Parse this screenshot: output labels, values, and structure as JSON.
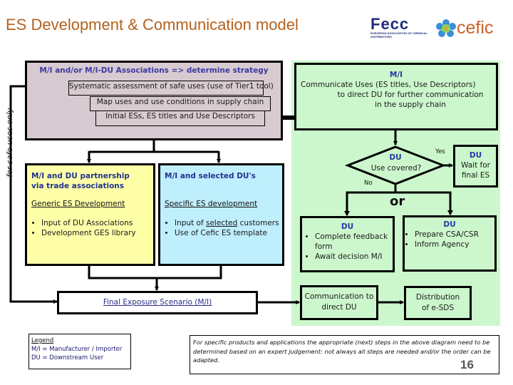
{
  "header": {
    "title": "ES Development & Communication model",
    "logos": [
      {
        "name": "Fecc",
        "subtitle": "EUROPEAN ASSOCIATION OF CHEMICAL DISTRIBUTORS",
        "color": "#1f2b7a"
      },
      {
        "name": "cefic",
        "color": "#c8622a"
      }
    ]
  },
  "side_label": "for safe uses only",
  "strategy_box": {
    "heading": "M/I and/or M/I-DU Associations => determine strategy",
    "steps": [
      "Systematic  assessment of safe uses (use of Tier1 tool)",
      "Map uses and use conditions in supply chain",
      "Initial ESs, ES titles and Use Descriptors"
    ]
  },
  "communicate_box": {
    "heading": "M/I",
    "lines": [
      "Communicate Uses (ES titles, Use Descriptors)",
      "to direct DU for further communication",
      "in the supply chain"
    ]
  },
  "generic_box": {
    "heading_lines": [
      "M/I and DU partnership",
      "via trade associations"
    ],
    "subheading": "Generic ES Development",
    "bullets": [
      "Input of DU Associations",
      "Development GES library"
    ]
  },
  "specific_box": {
    "heading": "M/I and selected DU's",
    "subheading": "Specific ES development",
    "bullets_html": [
      {
        "pre": "Input of ",
        "em": "selected",
        "post": " customers"
      },
      {
        "pre": "Use of Cefic ES template",
        "em": "",
        "post": ""
      }
    ]
  },
  "decision": {
    "heading": "DU",
    "question": "Use covered?",
    "yes_label": "Yes",
    "no_label": "No"
  },
  "wait_box": {
    "heading": "DU",
    "lines": [
      "Wait for",
      "final ES"
    ]
  },
  "or_label": "or",
  "feedback_box": {
    "heading": "DU",
    "bullets": [
      "Complete feedback form",
      "Await decision M/I"
    ]
  },
  "csa_box": {
    "heading": "DU",
    "bullets": [
      "Prepare CSA/CSR",
      "Inform Agency"
    ]
  },
  "final_es": "Final Exposure Scenario (M/I)",
  "communication_box": {
    "lines": [
      "Communication to",
      "direct DU"
    ]
  },
  "distribution_box": {
    "lines": [
      "Distribution",
      "of e-SDS"
    ]
  },
  "legend": {
    "title": "Legend",
    "entries": [
      "M/I = Manufacturer / Importer",
      "DU = Downstream User"
    ]
  },
  "note": "For specific products and applications the appropriate (next) steps in the above diagram need to be determined based on an expert judgement: not always all steps are needed and/or the order can be adapted.",
  "page_number": "16",
  "colors": {
    "title": "#b5611d",
    "strategy_bg": "#d8cad1",
    "du_zone_bg": "#ccf7cc",
    "generic_bg": "#ffffa8",
    "specific_bg": "#bfeefc",
    "heading_blue": "#22338f"
  }
}
